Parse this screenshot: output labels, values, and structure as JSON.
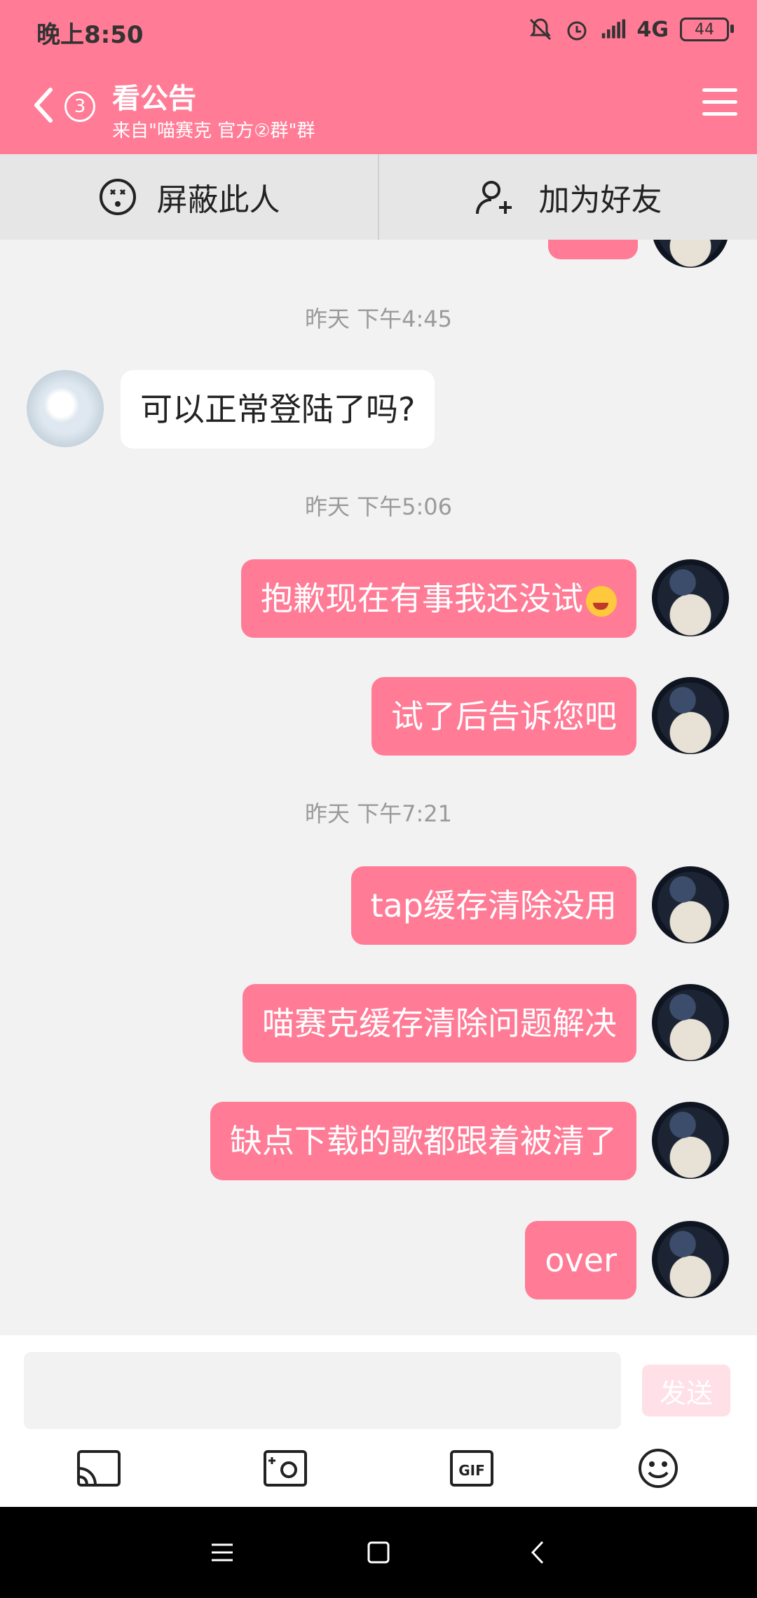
{
  "status_bar": {
    "time": "晚上8:50",
    "network": "4G",
    "battery": "44"
  },
  "header": {
    "unread_count": "3",
    "title": "看公告",
    "subtitle": "来自\"喵赛克 官方②群\"群",
    "background_color": "#ff7b96"
  },
  "actions": {
    "block_label": "屏蔽此人",
    "add_friend_label": "加为好友"
  },
  "chat": {
    "messages": [
      {
        "type": "timestamp",
        "text": "昨天 下午4:45"
      },
      {
        "type": "incoming",
        "text": "可以正常登陆了吗?"
      },
      {
        "type": "timestamp",
        "text": "昨天 下午5:06"
      },
      {
        "type": "outgoing",
        "text": "抱歉现在有事我还没试",
        "emoji": "face-with-tongue"
      },
      {
        "type": "outgoing",
        "text": "试了后告诉您吧"
      },
      {
        "type": "timestamp",
        "text": "昨天 下午7:21"
      },
      {
        "type": "outgoing",
        "text": "tap缓存清除没用"
      },
      {
        "type": "outgoing",
        "text": "喵赛克缓存清除问题解决"
      },
      {
        "type": "outgoing",
        "text": "缺点下载的歌都跟着被清了"
      },
      {
        "type": "outgoing",
        "text": "over"
      }
    ]
  },
  "composer": {
    "placeholder": "",
    "send_label": "发送"
  },
  "icons": {
    "tools": [
      "cast-icon",
      "camera-icon",
      "gif-icon",
      "emoji-icon"
    ],
    "nav": [
      "recent-apps-icon",
      "home-icon",
      "back-icon"
    ]
  }
}
